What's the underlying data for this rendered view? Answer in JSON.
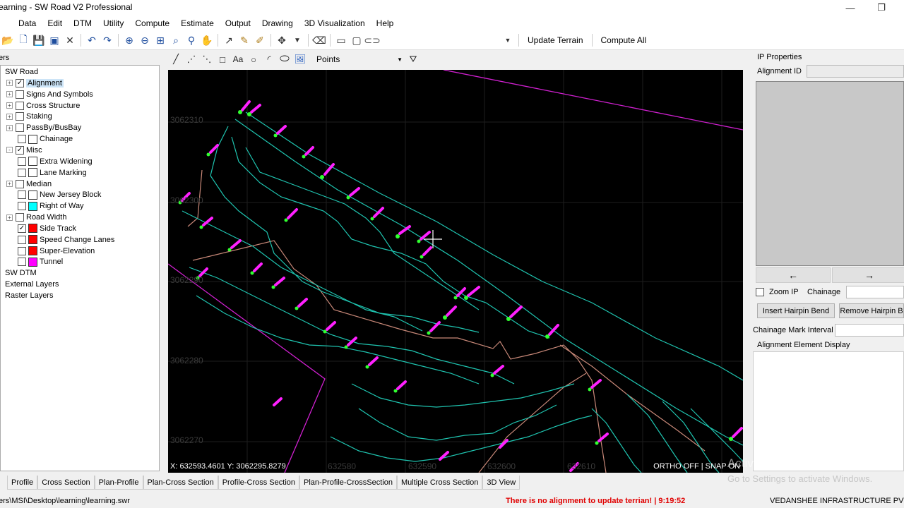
{
  "window": {
    "title": "earning - SW Road V2 Professional",
    "minimize_glyph": "—",
    "restore_glyph": "❐"
  },
  "menu": [
    "Data",
    "Edit",
    "DTM",
    "Utility",
    "Compute",
    "Estimate",
    "Output",
    "Drawing",
    "3D Visualization",
    "Help"
  ],
  "toolbar": {
    "icons": [
      "open-dropdown-icon",
      "new-icon",
      "save-icon",
      "save-as-icon",
      "close-x-icon",
      "undo-icon",
      "redo-icon",
      "zoom-in-icon",
      "zoom-out-icon",
      "zoom-extent-icon",
      "zoom-window-icon",
      "pick-icon",
      "pan-icon",
      "line-tool-icon",
      "edit-tool-icon",
      "pen-icon",
      "move-icon",
      "eraser-icon",
      "measure-icon",
      "frame-icon",
      "link-icon"
    ],
    "update_terrain": "Update Terrain",
    "compute_all": "Compute All"
  },
  "layers": {
    "header": "ers",
    "items": [
      {
        "label": "SW Road",
        "level": 0,
        "expander": "",
        "check": null,
        "swatch": null
      },
      {
        "label": "Alignment",
        "level": 1,
        "expander": "+",
        "check": true,
        "swatch": null,
        "selected": true
      },
      {
        "label": "Signs And Symbols",
        "level": 1,
        "expander": "+",
        "check": false,
        "swatch": null
      },
      {
        "label": "Cross Structure",
        "level": 1,
        "expander": "+",
        "check": false,
        "swatch": null
      },
      {
        "label": "Staking",
        "level": 1,
        "expander": "+",
        "check": false,
        "swatch": null
      },
      {
        "label": "PassBy/BusBay",
        "level": 1,
        "expander": "+",
        "check": false,
        "swatch": null
      },
      {
        "label": "Chainage",
        "level": 2,
        "expander": "",
        "check": false,
        "swatch": "#ffffff"
      },
      {
        "label": "Misc",
        "level": 1,
        "expander": "-",
        "check": true,
        "swatch": null
      },
      {
        "label": "Extra Widening",
        "level": 2,
        "expander": "",
        "check": false,
        "swatch": "#ffffff"
      },
      {
        "label": "Lane Marking",
        "level": 2,
        "expander": "",
        "check": false,
        "swatch": "#ffffff"
      },
      {
        "label": "Median",
        "level": 1,
        "expander": "+",
        "check": false,
        "swatch": null
      },
      {
        "label": "New Jersey Block",
        "level": 2,
        "expander": "",
        "check": false,
        "swatch": "#ffffff"
      },
      {
        "label": "Right of Way",
        "level": 2,
        "expander": "",
        "check": false,
        "swatch": "#00ffff"
      },
      {
        "label": "Road Width",
        "level": 1,
        "expander": "+",
        "check": false,
        "swatch": null
      },
      {
        "label": "Side Track",
        "level": 2,
        "expander": "",
        "check": true,
        "swatch": "#ff0000"
      },
      {
        "label": "Speed Change Lanes",
        "level": 2,
        "expander": "",
        "check": false,
        "swatch": "#ff0000"
      },
      {
        "label": "Super-Elevation",
        "level": 2,
        "expander": "",
        "check": false,
        "swatch": "#ff0000"
      },
      {
        "label": "Tunnel",
        "level": 2,
        "expander": "",
        "check": false,
        "swatch": "#ff00ff"
      },
      {
        "label": "SW DTM",
        "level": 0,
        "expander": "",
        "check": null,
        "swatch": null
      },
      {
        "label": "External Layers",
        "level": 0,
        "expander": "",
        "check": null,
        "swatch": null
      },
      {
        "label": "Raster Layers",
        "level": 0,
        "expander": "",
        "check": null,
        "swatch": null
      }
    ]
  },
  "drawbar": {
    "icons": [
      "line-draw-icon",
      "polyline-icon",
      "multiline-icon",
      "rectangle-icon",
      "text-icon",
      "circle-icon",
      "arc-icon",
      "ellipse-icon",
      "image-icon"
    ],
    "text_icon_label": "Aa",
    "points_label": "Points",
    "filter_icon": "filter-icon"
  },
  "viewport": {
    "coords": "X: 632593.4601 Y: 3062295.8279",
    "snap": "ORTHO OFF | SNAP ON",
    "y_labels": [
      "3062310",
      "3062300",
      "3062290",
      "3062280",
      "3062270"
    ],
    "x_labels": [
      "632580",
      "632590",
      "632600",
      "632610"
    ],
    "colors": {
      "contour": "#1fc4b0",
      "boundary": "#d020d0",
      "road": "#c88878",
      "marker": "#ff20ff",
      "marker_base": "#30ff30"
    }
  },
  "right_panel": {
    "section_title": "IP Properties",
    "alignment_id_label": "Alignment ID",
    "alignment_id_value": "",
    "prev_arrow": "←",
    "next_arrow": "→",
    "zoom_ip_label": "Zoom IP",
    "zoom_ip_checked": false,
    "chainage_label": "Chainage",
    "chainage_value": "",
    "insert_hairpin": "Insert Hairpin Bend",
    "remove_hairpin": "Remove Hairpin B",
    "chainage_mark_interval_label": "Chainage Mark Interval",
    "chainage_mark_interval_value": "",
    "alignment_element_display": "Alignment Element Display"
  },
  "tabs": [
    "Profile",
    "Cross Section",
    "Plan-Profile",
    "Plan-Cross Section",
    "Profile-Cross Section",
    "Plan-Profile-CrossSection",
    "Multiple Cross Section",
    "3D View"
  ],
  "status": {
    "path": "ers\\MSI\\Desktop\\learning\\learning.swr",
    "warning": "There is no alignment to update terrian! | 9:19:52",
    "company": "VEDANSHEE INFRASTRUCTURE PVT."
  },
  "watermark": {
    "line1": "Activate Windows",
    "line2": "Go to Settings to activate Windows."
  }
}
